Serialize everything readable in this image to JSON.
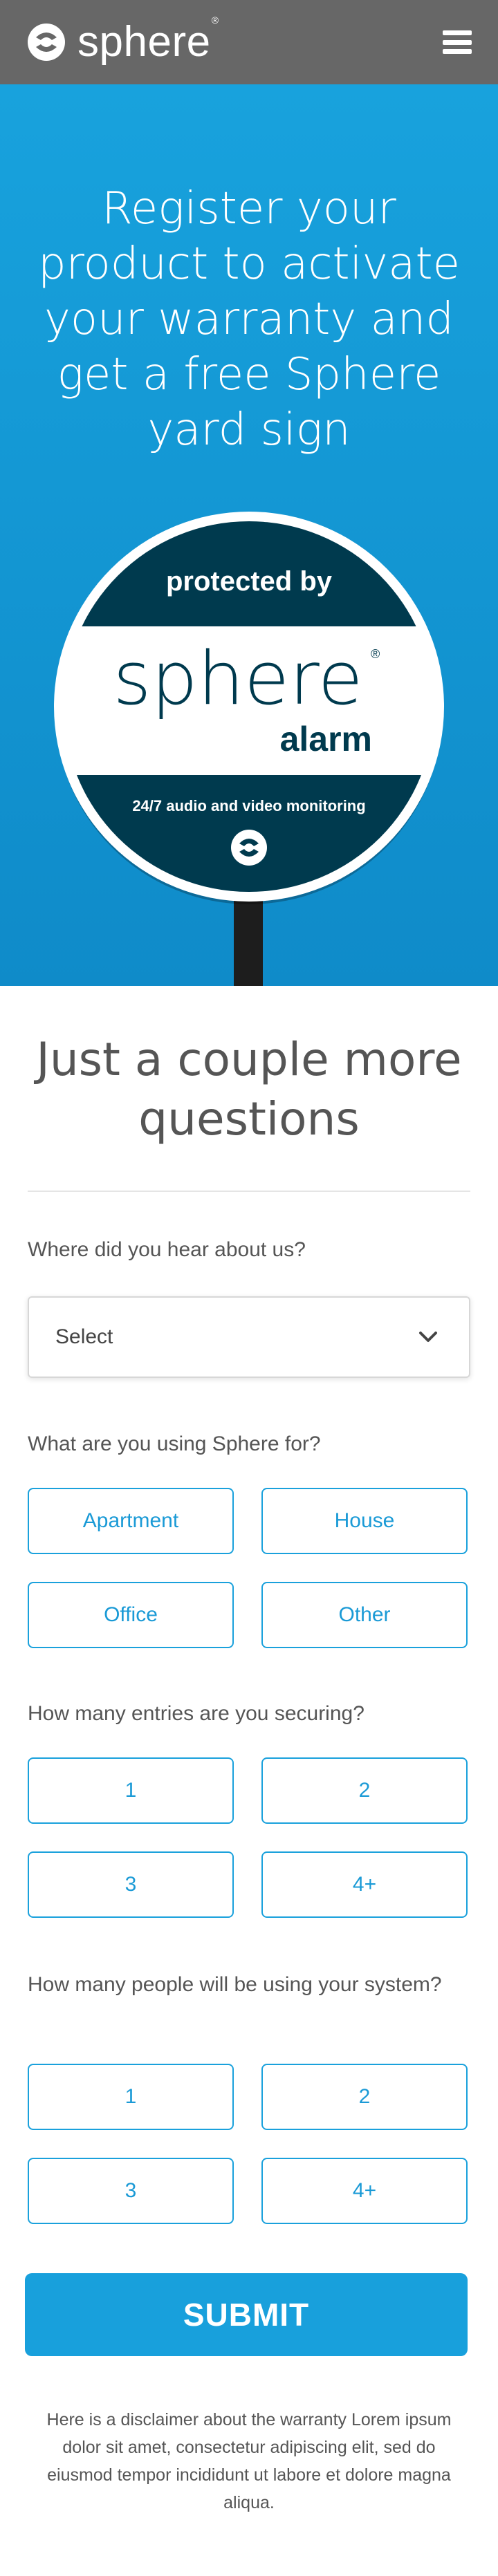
{
  "header": {
    "brand_name": "sphere",
    "brand_mark": "®",
    "menu_icon": "hamburger-icon",
    "logo_icon": "sphere-logo-icon",
    "background_color": "#676767"
  },
  "hero": {
    "title": "Register your product to activate your warranty and get a free Sphere yard sign",
    "background_color": "#18a2dd",
    "yard_sign": {
      "top_text": "protected by",
      "brand_text": "sphere",
      "brand_mark": "®",
      "product_text": "alarm",
      "tagline": "24/7 audio and video monitoring",
      "dark_color": "#003a4e"
    }
  },
  "form": {
    "title": "Just a couple more questions",
    "heard_about": {
      "label": "Where did you hear about us?",
      "selected": "Select"
    },
    "usage": {
      "label": "What are you using Sphere for?",
      "options": [
        "Apartment",
        "House",
        "Office",
        "Other"
      ]
    },
    "entries": {
      "label": "How many entries are you securing?",
      "options": [
        "1",
        "2",
        "3",
        "4+"
      ]
    },
    "people": {
      "label": "How many people will be using your system?",
      "options": [
        "1",
        "2",
        "3",
        "4+"
      ]
    },
    "submit_label": "SUBMIT",
    "accent_color": "#18a0dc",
    "disclaimer": "Here is a disclaimer about the warranty Lorem ipsum dolor sit amet, consectetur adipiscing elit, sed do eiusmod tempor incididunt ut labore et dolore magna aliqua."
  }
}
